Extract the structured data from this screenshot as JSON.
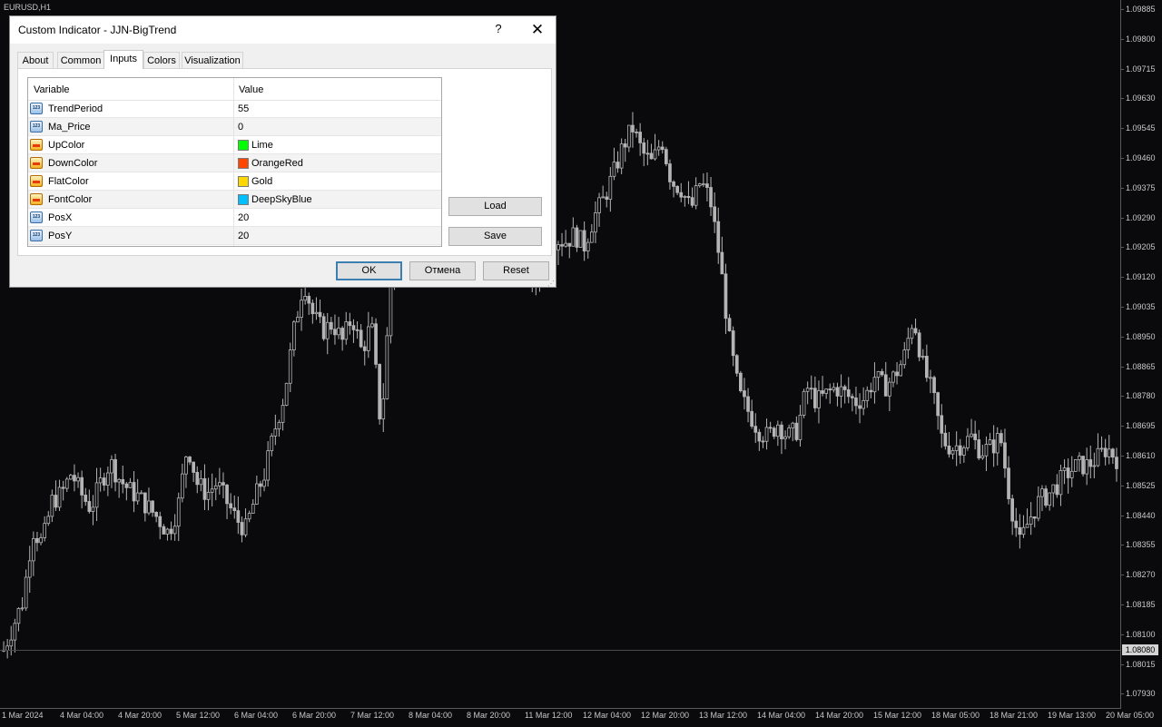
{
  "chart": {
    "symbol": "EURUSD,H1",
    "current_price": "1.08080",
    "price_axis": [
      "1.09885",
      "1.09800",
      "1.09715",
      "1.09630",
      "1.09545",
      "1.09460",
      "1.09375",
      "1.09290",
      "1.09205",
      "1.09120",
      "1.09035",
      "1.08950",
      "1.08865",
      "1.08780",
      "1.08695",
      "1.08610",
      "1.08525",
      "1.08440",
      "1.08355",
      "1.08270",
      "1.08185",
      "1.08100",
      "1.08015",
      "1.07930"
    ],
    "time_axis": [
      "1 Mar 2024",
      "4 Mar 04:00",
      "4 Mar 20:00",
      "5 Mar 12:00",
      "6 Mar 04:00",
      "6 Mar 20:00",
      "7 Mar 12:00",
      "8 Mar 04:00",
      "8 Mar 20:00",
      "11 Mar 12:00",
      "12 Mar 04:00",
      "12 Mar 20:00",
      "13 Mar 12:00",
      "14 Mar 04:00",
      "14 Mar 20:00",
      "15 Mar 12:00",
      "18 Mar 05:00",
      "18 Mar 21:00",
      "19 Mar 13:00",
      "20 Mar 05:00"
    ],
    "candle_color": "#b4b4b4",
    "background": "#0a0a0d",
    "price_series": [
      1.0808,
      1.0815,
      1.0822,
      1.0842,
      1.0838,
      1.085,
      1.0852,
      1.0858,
      1.0852,
      1.0848,
      1.0855,
      1.0861,
      1.0856,
      1.0853,
      1.0851,
      1.0848,
      1.0845,
      1.0841,
      1.0848,
      1.0866,
      1.0855,
      1.0852,
      1.0855,
      1.085,
      1.0845,
      1.0842,
      1.0851,
      1.0858,
      1.087,
      1.088,
      1.0898,
      1.0912,
      1.0902,
      1.0898,
      1.09,
      1.0895,
      1.0902,
      1.0892,
      1.09,
      1.087,
      1.0912,
      1.0935,
      1.0925,
      1.0918,
      1.0928,
      1.0932,
      1.0926,
      1.093,
      1.0935,
      1.0938,
      1.0922,
      1.0928,
      1.093,
      1.0921,
      1.0915,
      1.0912,
      1.092,
      1.0924,
      1.0923,
      1.0925,
      1.0922,
      1.093,
      1.0935,
      1.0942,
      1.095,
      1.0955,
      1.0948,
      1.0945,
      1.0952,
      1.094,
      1.0938,
      1.0932,
      1.094,
      1.0935,
      1.0918,
      1.0895,
      1.088,
      1.0875,
      1.087,
      1.0868,
      1.0872,
      1.0868,
      1.087,
      1.0882,
      1.0878,
      1.088,
      1.0882,
      1.088,
      1.0878,
      1.0879,
      1.0885,
      1.0882,
      1.0885,
      1.089,
      1.0902,
      1.0888,
      1.088,
      1.0867,
      1.0865,
      1.0866,
      1.0868,
      1.0864,
      1.0865,
      1.0868,
      1.085,
      1.0838,
      1.0845,
      1.085,
      1.0852,
      1.0855,
      1.0858,
      1.086,
      1.086,
      1.0862,
      1.0865,
      1.0862
    ]
  },
  "dialog": {
    "title": "Custom Indicator - JJN-BigTrend",
    "help": "?",
    "close": "✕",
    "tabs": [
      "About",
      "Common",
      "Inputs",
      "Colors",
      "Visualization"
    ],
    "active_tab": "Inputs",
    "columns": [
      "Variable",
      "Value"
    ],
    "inputs": [
      {
        "name": "TrendPeriod",
        "value": "55",
        "type": "num"
      },
      {
        "name": "Ma_Price",
        "value": "0",
        "type": "num"
      },
      {
        "name": "UpColor",
        "value": "Lime",
        "type": "color",
        "color": "#00ff00"
      },
      {
        "name": "DownColor",
        "value": "OrangeRed",
        "type": "color",
        "color": "#ff4500"
      },
      {
        "name": "FlatColor",
        "value": "Gold",
        "type": "color",
        "color": "#ffd700"
      },
      {
        "name": "FontColor",
        "value": "DeepSkyBlue",
        "type": "color",
        "color": "#00bfff"
      },
      {
        "name": "PosX",
        "value": "20",
        "type": "num"
      },
      {
        "name": "PosY",
        "value": "20",
        "type": "num"
      }
    ],
    "load_label": "Load",
    "save_label": "Save",
    "ok_label": "OK",
    "cancel_label": "Отмена",
    "reset_label": "Reset"
  }
}
